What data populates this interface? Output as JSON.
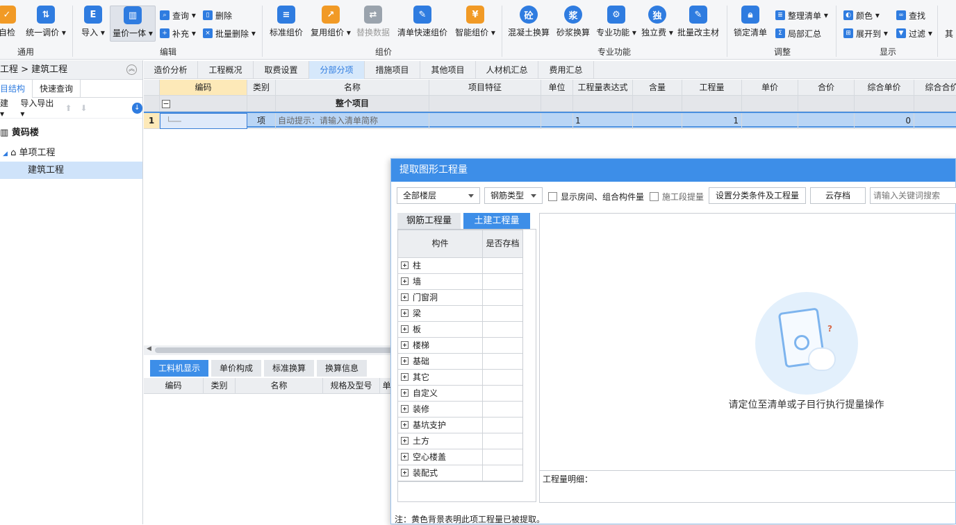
{
  "ribbon": {
    "groups": [
      "通用",
      "编辑",
      "组价",
      "专业功能",
      "调整",
      "显示"
    ],
    "general": {
      "self_check": "自检",
      "unify_price": "统一调价"
    },
    "edit": {
      "import": "导入",
      "qty_price": "量价一体",
      "query": "查询",
      "supplement": "补充",
      "delete": "删除",
      "batch_delete": "批量删除"
    },
    "pricing": {
      "standard": "标准组价",
      "reuse": "复用组价",
      "replace": "替换数据",
      "quick": "清单快速组价",
      "smart": "智能组价"
    },
    "special": {
      "concrete": "混凝土换算",
      "mortar": "砂浆换算",
      "pro": "专业功能",
      "independent": "独立费",
      "batch_material": "批量改主材"
    },
    "adjust": {
      "lock": "锁定清单",
      "organize": "整理清单",
      "partial": "局部汇总"
    },
    "display": {
      "color": "颜色",
      "find": "查找",
      "expand": "展开到",
      "filter": "过滤",
      "more": "其"
    }
  },
  "icons": {
    "concrete": "砼",
    "mortar": "浆",
    "independent": "独",
    "yuan": "¥"
  },
  "left": {
    "path": "工程 > 建筑工程",
    "tabs": [
      "目结构",
      "快速查询"
    ],
    "tools": [
      "建",
      "导入导出"
    ],
    "tree": [
      {
        "label": "黄码楼",
        "level": 0
      },
      {
        "label": "单项工程",
        "level": 1
      },
      {
        "label": "建筑工程",
        "level": 2
      }
    ]
  },
  "main_tabs": [
    "造价分析",
    "工程概况",
    "取费设置",
    "分部分项",
    "措施项目",
    "其他项目",
    "人材机汇总",
    "费用汇总"
  ],
  "grid": {
    "headers": [
      "编码",
      "类别",
      "名称",
      "项目特征",
      "单位",
      "工程量表达式",
      "含量",
      "工程量",
      "单价",
      "合价",
      "综合单价",
      "综合合价"
    ],
    "group_row": "整个项目",
    "row": {
      "num": "1",
      "type": "项",
      "name_hint": "自动提示：请输入清单简称",
      "qty_expr": "1",
      "qty": "1",
      "total": "0"
    }
  },
  "bottom": {
    "tabs": [
      "工料机显示",
      "单价构成",
      "标准换算",
      "换算信息"
    ],
    "headers": [
      "编码",
      "类别",
      "名称",
      "规格及型号",
      "单"
    ]
  },
  "dialog": {
    "title": "提取图形工程量",
    "floor": "全部楼层",
    "rebar_type": "钢筋类型",
    "show_rooms": "显示房间、组合构件量",
    "construction_stage": "施工段提量",
    "set_conditions": "设置分类条件及工程量",
    "cloud": "云存档",
    "search_placeholder": "请输入关键词搜索",
    "tabs": [
      "钢筋工程量",
      "土建工程量"
    ],
    "tree_headers": [
      "构件",
      "是否存档"
    ],
    "components": [
      "柱",
      "墙",
      "门窗洞",
      "梁",
      "板",
      "楼梯",
      "基础",
      "其它",
      "自定义",
      "装修",
      "基坑支护",
      "土方",
      "空心楼盖",
      "装配式"
    ],
    "empty_hint": "请定位至清单或子目行执行提量操作",
    "detail_label": "工程量明细：",
    "note": "注：黄色背景表明此项工程量已被提取。"
  }
}
